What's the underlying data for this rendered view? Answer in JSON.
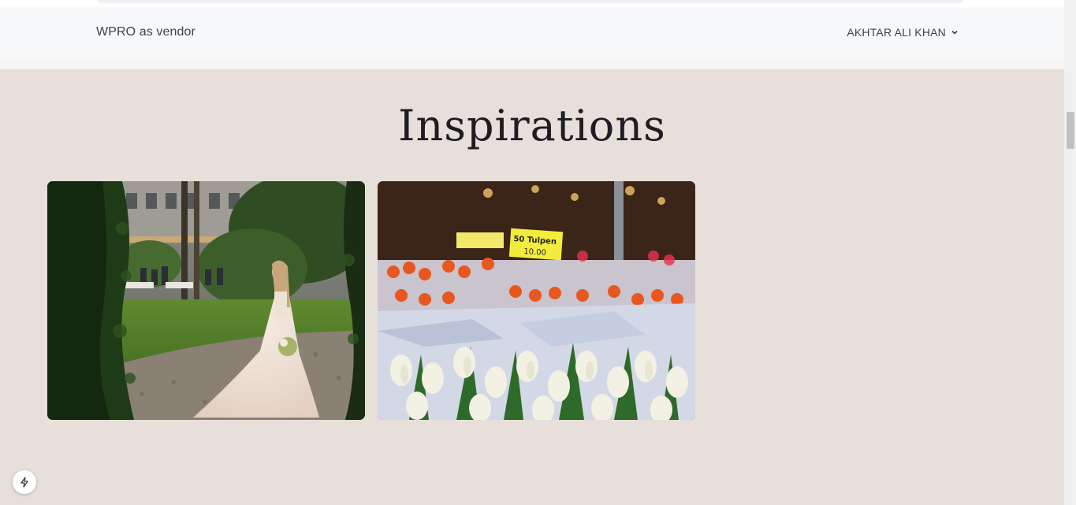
{
  "navbar": {
    "brand": "WPRO as vendor",
    "user_name": "AKHTAR ALI KHAN",
    "user_menu_icon": "chevron-down-icon"
  },
  "section": {
    "title": "Inspirations"
  },
  "gallery": [
    {
      "image": "bride-in-garden-photo"
    },
    {
      "image": "tulip-flower-market-photo",
      "sign": {
        "line1": "50 Tulpen",
        "line2": "10.00"
      }
    }
  ],
  "dev_badge": {
    "icon": "lightning-bolt-icon"
  },
  "colors": {
    "page_background": "#e7e0da",
    "navbar_background": "#f7f8fa",
    "text": "#3e4150",
    "title": "#1d1d22"
  }
}
